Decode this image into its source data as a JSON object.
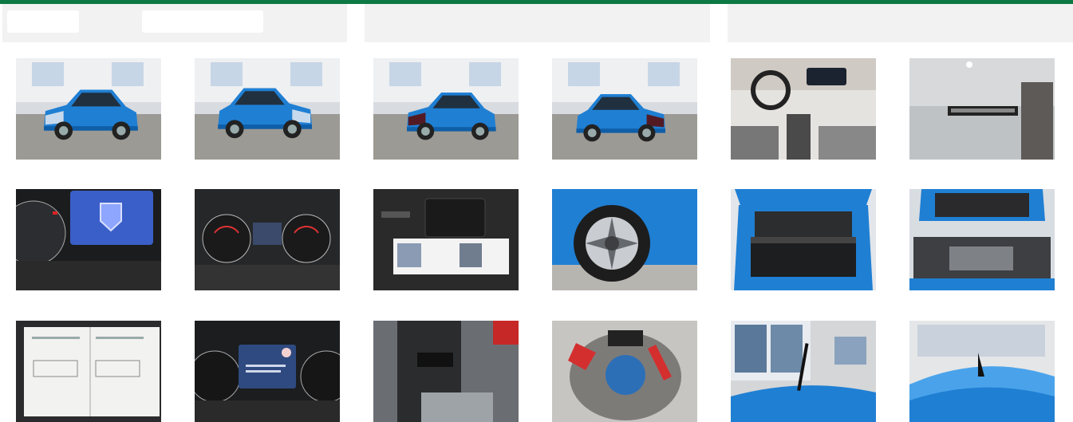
{
  "theme": {
    "accent": "#0e7a43",
    "header_bg": "#f2f2f2"
  },
  "photos": [
    {
      "name": "photo-front-left-blue-hatchback",
      "scene": "car-front-left"
    },
    {
      "name": "photo-front-right-blue-hatchback",
      "scene": "car-front-right"
    },
    {
      "name": "photo-rear-left-blue-hatchback",
      "scene": "car-rear"
    },
    {
      "name": "photo-rear-right-blue-hatchback",
      "scene": "car-rear-right"
    },
    {
      "name": "photo-interior-dashboard",
      "scene": "interior"
    },
    {
      "name": "photo-key-tag",
      "scene": "key-tag"
    },
    {
      "name": "photo-instrument-cluster-logo",
      "scene": "cluster-logo"
    },
    {
      "name": "photo-instrument-cluster-gauges",
      "scene": "cluster-gauges"
    },
    {
      "name": "photo-documents-and-manual",
      "scene": "documents"
    },
    {
      "name": "photo-alloy-wheel",
      "scene": "wheel"
    },
    {
      "name": "photo-open-trunk",
      "scene": "trunk"
    },
    {
      "name": "photo-engine-bay",
      "scene": "engine"
    },
    {
      "name": "photo-service-booklet",
      "scene": "booklet"
    },
    {
      "name": "photo-cluster-service-message",
      "scene": "cluster-message"
    },
    {
      "name": "photo-underbody-suspension",
      "scene": "underbody"
    },
    {
      "name": "photo-spare-wheel-well",
      "scene": "spare-well"
    },
    {
      "name": "photo-roof-antenna-window",
      "scene": "roof-antenna"
    },
    {
      "name": "photo-roof-antenna-closeup",
      "scene": "roof-closeup"
    }
  ]
}
